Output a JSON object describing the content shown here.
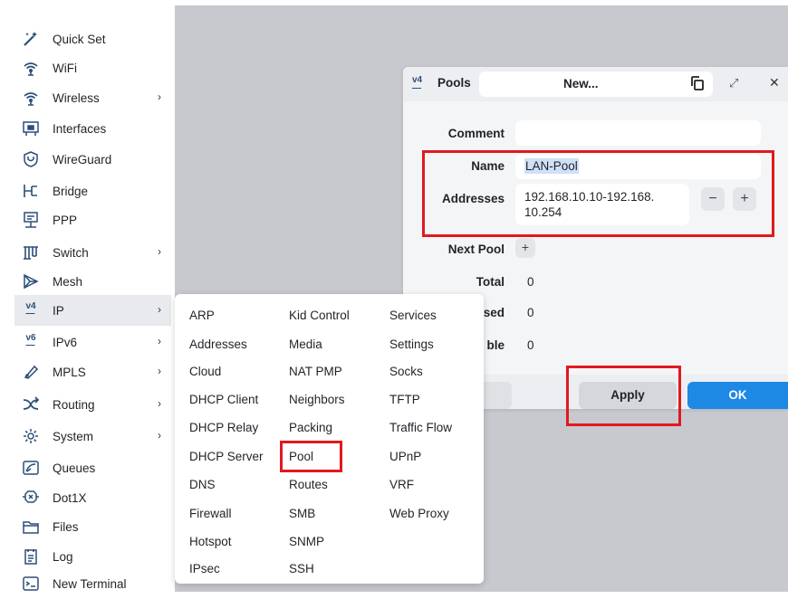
{
  "sidebar": {
    "items": [
      {
        "label": "Quick Set",
        "icon": "magic-wand-icon",
        "arrow": ""
      },
      {
        "label": "WiFi",
        "icon": "wifi-icon",
        "arrow": ""
      },
      {
        "label": "Wireless",
        "icon": "wireless-icon",
        "arrow": "›"
      },
      {
        "label": "Interfaces",
        "icon": "interfaces-icon",
        "arrow": ""
      },
      {
        "label": "WireGuard",
        "icon": "wireguard-icon",
        "arrow": ""
      },
      {
        "label": "Bridge",
        "icon": "bridge-icon",
        "arrow": ""
      },
      {
        "label": "PPP",
        "icon": "ppp-icon",
        "arrow": ""
      },
      {
        "label": "Switch",
        "icon": "switch-icon",
        "arrow": "›"
      },
      {
        "label": "Mesh",
        "icon": "mesh-icon",
        "arrow": ""
      },
      {
        "label": "IP",
        "icon": "ip-icon",
        "arrow": "›"
      },
      {
        "label": "IPv6",
        "icon": "ipv6-icon",
        "arrow": "›"
      },
      {
        "label": "MPLS",
        "icon": "mpls-icon",
        "arrow": "›"
      },
      {
        "label": "Routing",
        "icon": "routing-icon",
        "arrow": "›"
      },
      {
        "label": "System",
        "icon": "system-gear-icon",
        "arrow": "›"
      },
      {
        "label": "Queues",
        "icon": "queues-icon",
        "arrow": ""
      },
      {
        "label": "Dot1X",
        "icon": "dot1x-icon",
        "arrow": ""
      },
      {
        "label": "Files",
        "icon": "folder-icon",
        "arrow": ""
      },
      {
        "label": "Log",
        "icon": "log-icon",
        "arrow": ""
      },
      {
        "label": "New Terminal",
        "icon": "terminal-icon",
        "arrow": ""
      }
    ]
  },
  "submenu": {
    "col1": [
      "ARP",
      "Addresses",
      "Cloud",
      "DHCP Client",
      "DHCP Relay",
      "DHCP Server",
      "DNS",
      "Firewall",
      "Hotspot",
      "IPsec"
    ],
    "col2": [
      "Kid Control",
      "Media",
      "NAT PMP",
      "Neighbors",
      "Packing",
      "Pool",
      "Routes",
      "SMB",
      "SNMP",
      "SSH"
    ],
    "col3": [
      "Services",
      "Settings",
      "Socks",
      "TFTP",
      "Traffic Flow",
      "UPnP",
      "VRF",
      "Web Proxy"
    ]
  },
  "dialog": {
    "title": "Pools",
    "title_icon": "v4",
    "tab_label": "New...",
    "comment_label": "Comment",
    "comment_value": "",
    "name_label": "Name",
    "name_value": "LAN-Pool",
    "addresses_label": "Addresses",
    "addresses_value_line1": "192.168.10.10-192.168.",
    "addresses_value_line2": "10.254",
    "minus": "−",
    "plus": "+",
    "next_pool_label": "Next Pool",
    "total_label": "Total",
    "total_value": "0",
    "used_label": "sed",
    "used_value": "0",
    "available_label": "ble",
    "available_value": "0",
    "apply_label": "Apply",
    "ok_label": "OK"
  },
  "colors": {
    "accent": "#1e88e5",
    "highlight": "#e0191e",
    "workspace": "#c7c9ce"
  }
}
